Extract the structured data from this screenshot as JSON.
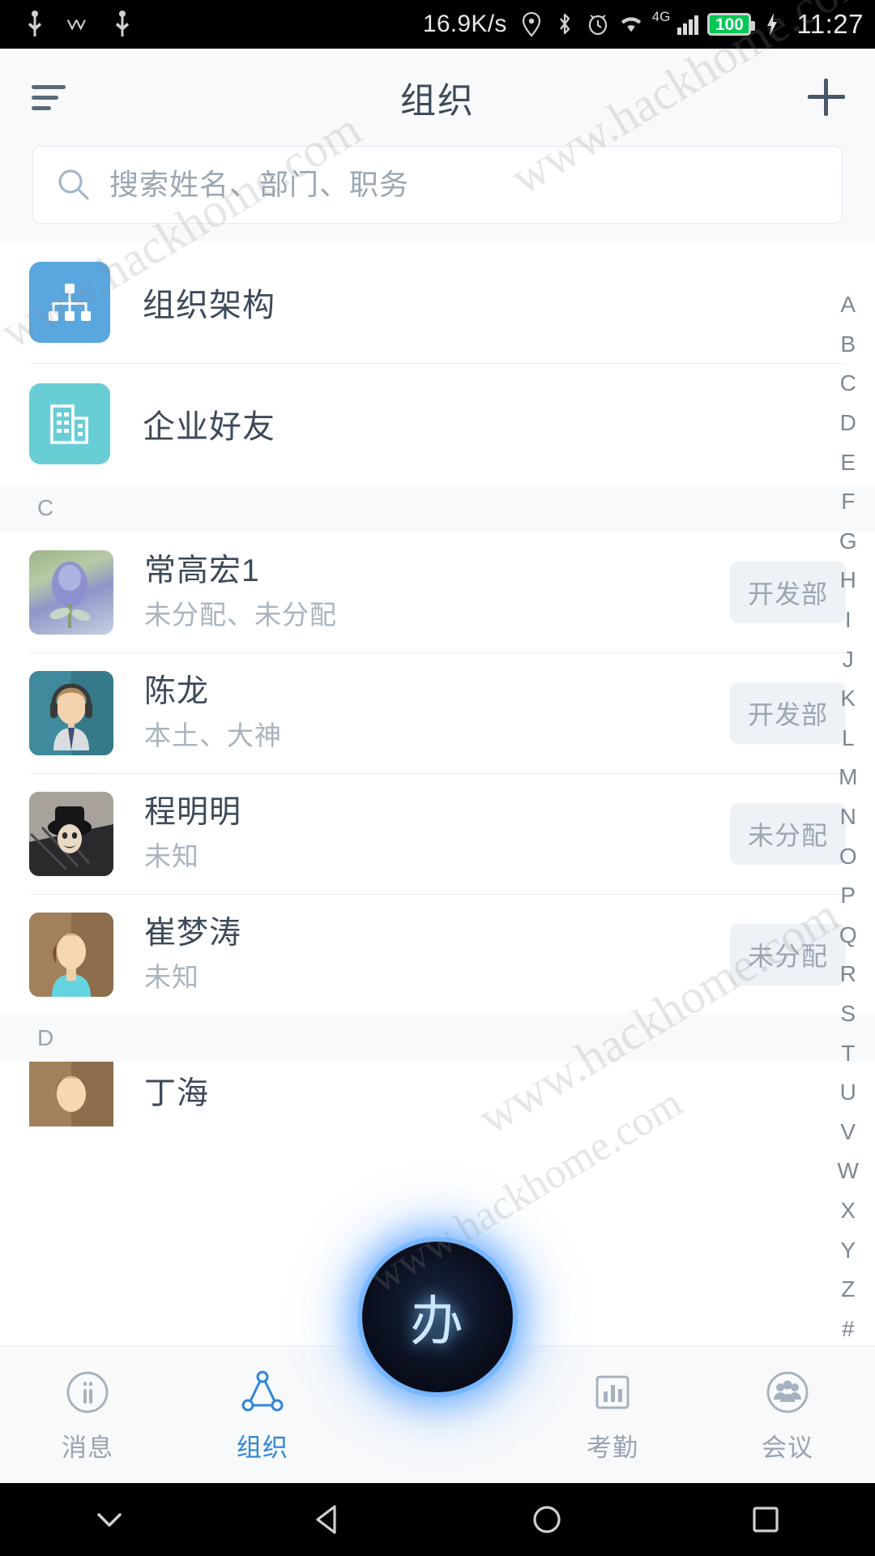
{
  "status_bar": {
    "net_speed": "16.9K/s",
    "battery_level": "100",
    "clock": "11:27",
    "network_type": "4G",
    "icons": [
      "usb-icon",
      "double-check-icon",
      "usb-icon",
      "location-icon",
      "bluetooth-icon",
      "alarm-icon",
      "wifi-icon",
      "signal-icon",
      "battery-icon",
      "charging-bolt-icon"
    ],
    "colors": {
      "battery_fill": "#00c853",
      "background": "#000000",
      "text": "#d8d8d8"
    }
  },
  "header": {
    "title": "组织",
    "menu_icon": "hamburger-menu-icon",
    "add_icon": "plus-icon"
  },
  "search": {
    "placeholder": "搜索姓名、部门、职务",
    "value": "",
    "icon": "search-icon"
  },
  "features": [
    {
      "label": "组织架构",
      "icon": "org-chart-icon",
      "color": "#5aa7e0"
    },
    {
      "label": "企业好友",
      "icon": "building-icon",
      "color": "#69cdd6"
    }
  ],
  "sections": [
    {
      "letter": "C",
      "contacts": [
        {
          "name": "常高宏1",
          "subtitle": "未分配、未分配",
          "badge": "开发部",
          "avatar": "flower-photo-avatar"
        },
        {
          "name": "陈龙",
          "subtitle": "本土、大神",
          "badge": "开发部",
          "avatar": "headset-person-avatar"
        },
        {
          "name": "程明明",
          "subtitle": "未知",
          "badge": "未分配",
          "avatar": "masked-person-avatar"
        },
        {
          "name": "崔梦涛",
          "subtitle": "未知",
          "badge": "未分配",
          "avatar": "brown-person-avatar"
        }
      ]
    },
    {
      "letter": "D",
      "contacts": [
        {
          "name": "丁海",
          "subtitle": "",
          "badge": "",
          "avatar": "brown-person-avatar"
        }
      ]
    }
  ],
  "index_bar": [
    "A",
    "B",
    "C",
    "D",
    "E",
    "F",
    "G",
    "H",
    "I",
    "J",
    "K",
    "L",
    "M",
    "N",
    "O",
    "P",
    "Q",
    "R",
    "S",
    "T",
    "U",
    "V",
    "W",
    "X",
    "Y",
    "Z",
    "#"
  ],
  "bottom_nav": {
    "items": [
      {
        "label": "消息",
        "icon": "message-icon",
        "active": false
      },
      {
        "label": "组织",
        "icon": "org-node-icon",
        "active": true
      },
      {
        "label": "考勤",
        "icon": "chart-bar-icon",
        "active": false
      },
      {
        "label": "会议",
        "icon": "meeting-icon",
        "active": false
      }
    ],
    "fab_label": "办",
    "accent_color": "#2f86d8"
  },
  "android_nav": {
    "buttons": [
      "chevron-down-icon",
      "back-triangle-icon",
      "home-circle-icon",
      "recents-square-icon"
    ]
  },
  "watermarks": [
    "www.hackhome.com",
    "www.hackhome.com",
    "www.hackhome.com",
    "www.hackhome.com"
  ]
}
